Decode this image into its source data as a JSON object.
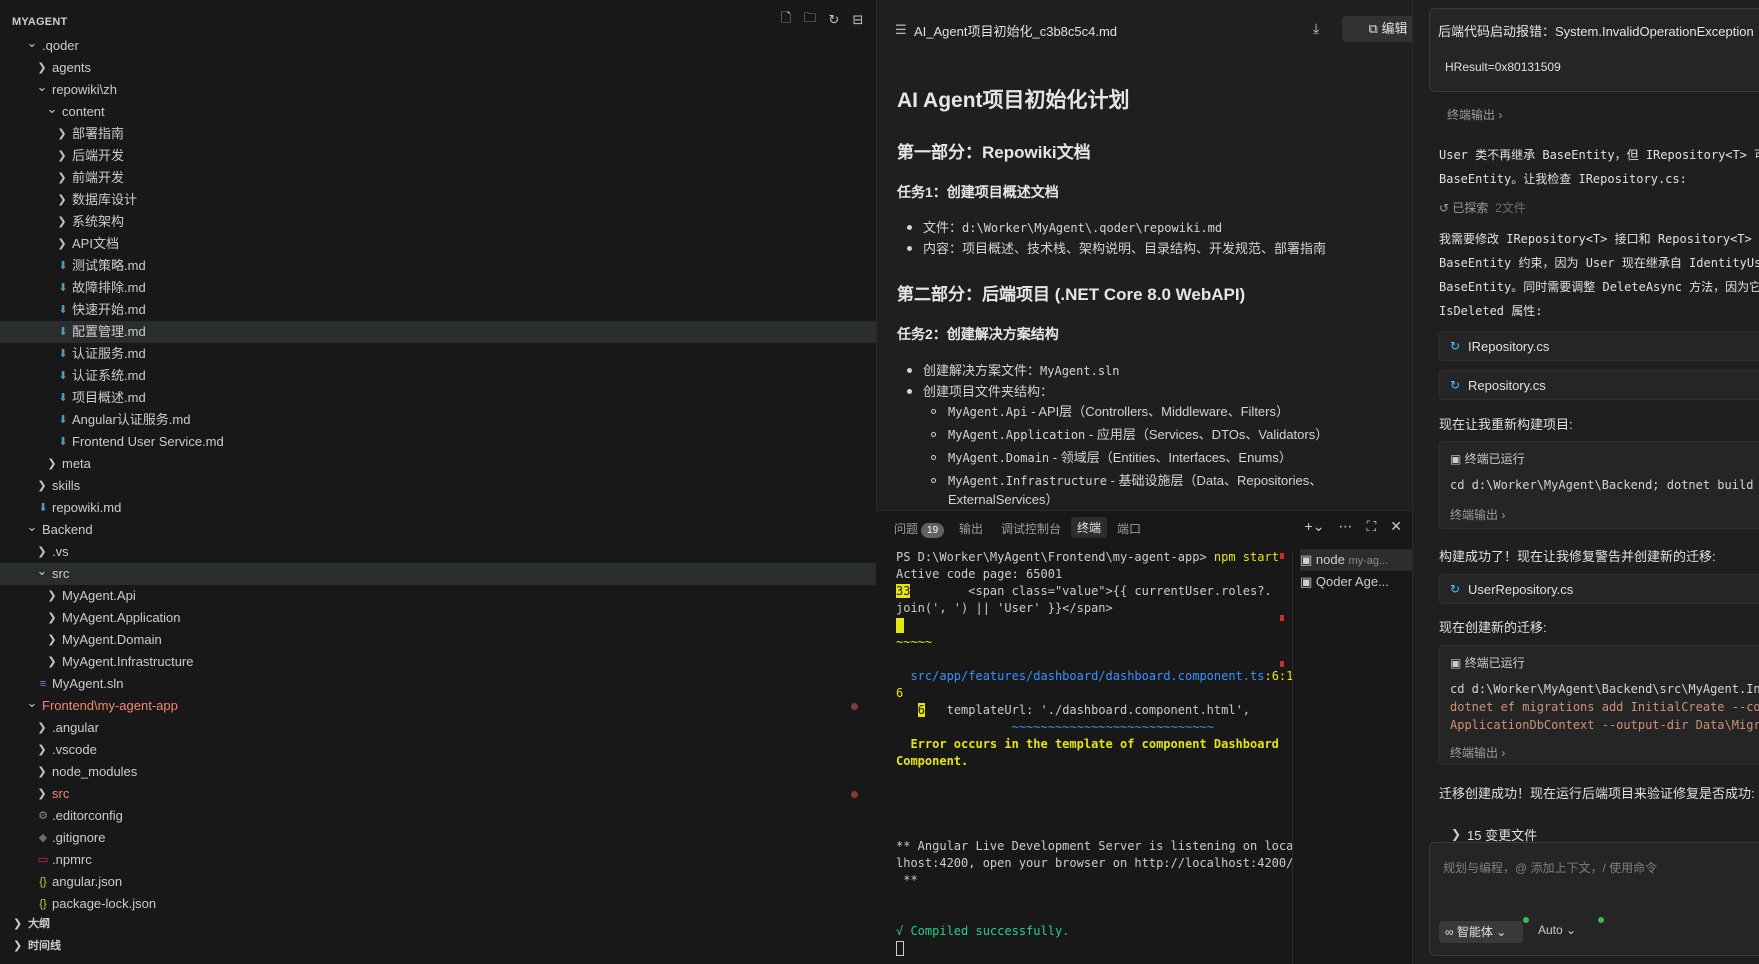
{
  "explorer": {
    "title": "MYAGENT",
    "items": [
      {
        "label": ".qoder",
        "type": "folder-open"
      },
      {
        "label": "agents",
        "type": "folder"
      },
      {
        "label": "repowiki\\zh",
        "type": "folder-open"
      },
      {
        "label": "content",
        "type": "folder-open"
      },
      {
        "label": "部署指南",
        "type": "folder"
      },
      {
        "label": "后端开发",
        "type": "folder"
      },
      {
        "label": "前端开发",
        "type": "folder"
      },
      {
        "label": "数据库设计",
        "type": "folder"
      },
      {
        "label": "系统架构",
        "type": "folder"
      },
      {
        "label": "API文档",
        "type": "folder"
      },
      {
        "label": "测试策略.md",
        "type": "md"
      },
      {
        "label": "故障排除.md",
        "type": "md"
      },
      {
        "label": "快速开始.md",
        "type": "md"
      },
      {
        "label": "配置管理.md",
        "type": "md",
        "selected": true
      },
      {
        "label": "认证服务.md",
        "type": "md"
      },
      {
        "label": "认证系统.md",
        "type": "md"
      },
      {
        "label": "项目概述.md",
        "type": "md"
      },
      {
        "label": "Angular认证服务.md",
        "type": "md"
      },
      {
        "label": "Frontend User Service.md",
        "type": "md"
      },
      {
        "label": "meta",
        "type": "folder"
      },
      {
        "label": "skills",
        "type": "folder"
      },
      {
        "label": "repowiki.md",
        "type": "md"
      },
      {
        "label": "Backend",
        "type": "folder-open"
      },
      {
        "label": ".vs",
        "type": "folder"
      },
      {
        "label": "src",
        "type": "folder-open",
        "selected": true
      },
      {
        "label": "MyAgent.Api",
        "type": "folder"
      },
      {
        "label": "MyAgent.Application",
        "type": "folder"
      },
      {
        "label": "MyAgent.Domain",
        "type": "folder"
      },
      {
        "label": "MyAgent.Infrastructure",
        "type": "folder"
      },
      {
        "label": "MyAgent.sln",
        "type": "sln"
      },
      {
        "label": "Frontend\\my-agent-app",
        "type": "folder-open",
        "status": "error"
      },
      {
        "label": ".angular",
        "type": "folder"
      },
      {
        "label": ".vscode",
        "type": "folder"
      },
      {
        "label": "node_modules",
        "type": "folder"
      },
      {
        "label": "src",
        "type": "folder",
        "status": "error"
      },
      {
        "label": ".editorconfig",
        "type": "config"
      },
      {
        "label": ".gitignore",
        "type": "git"
      },
      {
        "label": ".npmrc",
        "type": "npm"
      },
      {
        "label": "angular.json",
        "type": "json"
      },
      {
        "label": "package-lock.json",
        "type": "json"
      }
    ],
    "outline_label": "大纲",
    "timeline_label": "时间线"
  },
  "editor": {
    "tab_title": "AI_Agent项目初始化_c3b8c5c4.md",
    "edit_label": "编辑",
    "doc": {
      "h1": "AI Agent项目初始化计划",
      "part1": "第一部分：Repowiki文档",
      "task1": "任务1：创建项目概述文档",
      "task1_file_label": "文件：",
      "task1_file_path": "d:\\Worker\\MyAgent\\.qoder\\repowiki.md",
      "task1_content": "内容：项目概述、技术栈、架构说明、目录结构、开发规范、部署指南",
      "part2": "第二部分：后端项目 (.NET Core 8.0 WebAPI)",
      "task2": "任务2：创建解决方案结构",
      "task2_item1_label": "创建解决方案文件：",
      "task2_item1_code": "MyAgent.sln",
      "task2_item2": "创建项目文件夹结构：",
      "sub1_code": "MyAgent.Api",
      "sub1_text": " - API层（Controllers、Middleware、Filters）",
      "sub2_code": "MyAgent.Application",
      "sub2_text": " - 应用层（Services、DTOs、Validators）",
      "sub3_code": "MyAgent.Domain",
      "sub3_text": " - 领域层（Entities、Interfaces、Enums）",
      "sub4_code": "MyAgent.Infrastructure",
      "sub4_text": " - 基础设施层（Data、Repositories、",
      "sub4_cont": "ExternalServices）"
    }
  },
  "panel": {
    "tabs": [
      "问题",
      "输出",
      "调试控制台",
      "终端",
      "端口"
    ],
    "problems_count": "19",
    "active_tab": "终端",
    "terminal": {
      "prompt": "PS D:\\Worker\\MyAgent\\Frontend\\my-agent-app>",
      "command": "npm start",
      "l1": "Active code page: 65001",
      "l2_num": "33",
      "l2": "        <span class=\"value\">{{ currentUser.roles?.",
      "l3": "join(', ') || 'User' }}</span>",
      "l4": "~~~~~",
      "l5": "src/app/features/dashboard/dashboard.component.ts",
      "l5b": ":6:1",
      "l6": "6",
      "l7_num": "6",
      "l7": "   templateUrl: './dashboard.component.html',",
      "l8": "                ~~~~~~~~~~~~~~~~~~~~~~~~~~~~",
      "l9": "  Error occurs in the template of component Dashboard",
      "l10": "Component.",
      "l11": "** Angular Live Development Server is listening on loca",
      "l12": "lhost:4200, open your browser on http://localhost:4200/",
      "l13": " **",
      "l14": "√ Compiled successfully."
    },
    "terminals": [
      {
        "name": "node",
        "detail": "my-ag..."
      },
      {
        "name": "Qoder Age...",
        "detail": ""
      }
    ]
  },
  "chat": {
    "error_title": "后端代码启动报错：System.InvalidOperationException",
    "error_detail": "HResult=0x80131509",
    "terminal_output": "终端输出",
    "p1a": "User 类不再继承 BaseEntity，但 IRepository<T> 可",
    "p1b": "BaseEntity。让我检查 IRepository.cs:",
    "explored": "已探索",
    "explored_count": "2文件",
    "p2a": "我需要修改 IRepository<T> 接口和 Repository<T> 类",
    "p2b": "BaseEntity 约束，因为 User 现在继承自 IdentityUse",
    "p2c": "BaseEntity。同时需要调整 DeleteAsync 方法，因为它",
    "p2d": "IsDeleted 属性:",
    "file1": "IRepository.cs",
    "file2": "Repository.cs",
    "p3": "现在让我重新构建项目:",
    "cmd_ran": "终端已运行",
    "cmd1": "cd d:\\Worker\\MyAgent\\Backend; dotnet build",
    "p4": "构建成功了！现在让我修复警告并创建新的迁移:",
    "file3": "UserRepository.cs",
    "p5": "现在创建新的迁移:",
    "cmd2a": "cd d:\\Worker\\MyAgent\\Backend\\src\\MyAgent.Infr",
    "cmd2b": "dotnet ef migrations add InitialCreate --cont",
    "cmd2c": "ApplicationDbContext --output-dir Data\\Migrat",
    "p6": "迁移创建成功！现在运行后端项目来验证修复是否成功:",
    "changed_files": "15 变更文件",
    "input_placeholder": "规划与编程，@ 添加上下文，/ 使用命令",
    "agent_mode": "智能体",
    "model": "Auto"
  },
  "colors": {
    "background": "#181818",
    "accent_error": "#f14c4c",
    "folder_error": "#f48771",
    "md_icon": "#519aba",
    "terminal_link": "#3794ff",
    "terminal_warn": "#e5e510",
    "success": "#23d18b"
  }
}
